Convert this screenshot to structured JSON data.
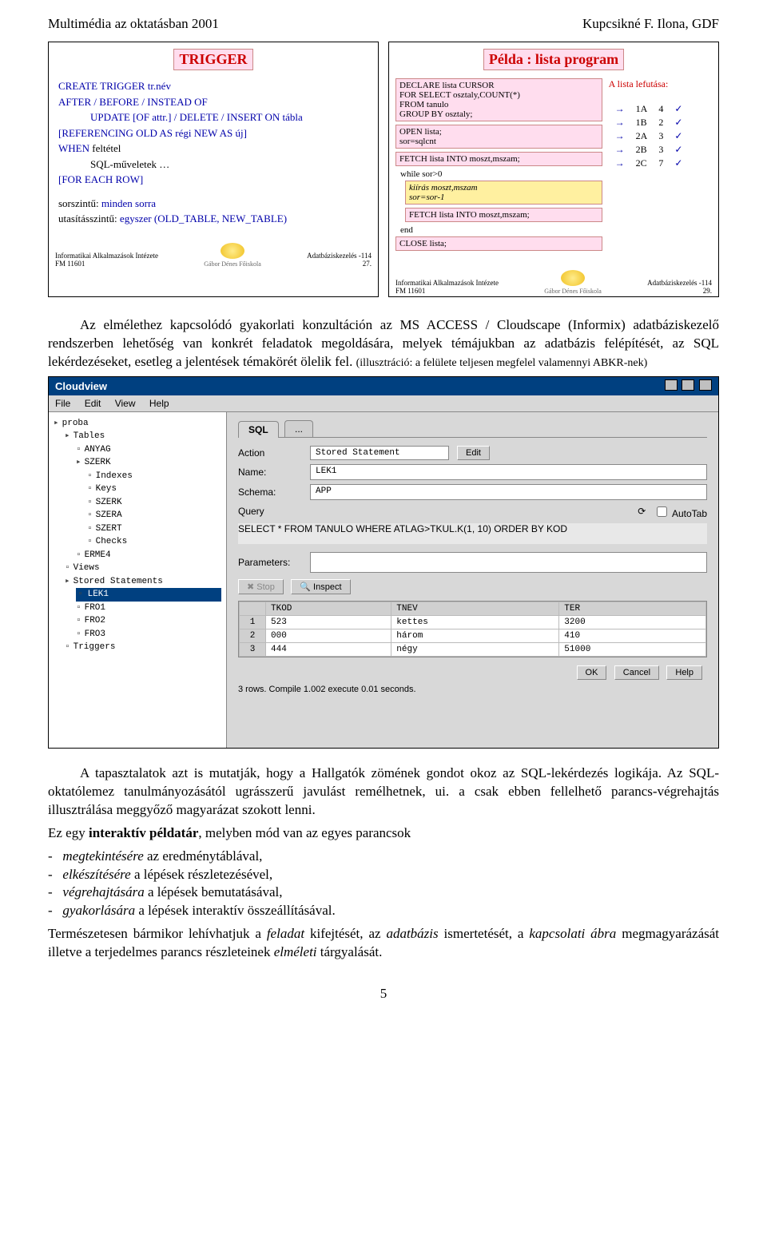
{
  "header": {
    "left": "Multimédia az oktatásban 2001",
    "right": "Kupcsikné F. Ilona, GDF"
  },
  "slide1": {
    "title": "TRIGGER",
    "l1": "CREATE TRIGGER tr.név",
    "l2": "AFTER / BEFORE / INSTEAD OF",
    "l3": "UPDATE [OF attr.] / DELETE / INSERT  ON tábla",
    "l4": "[REFERENCING  OLD AS régi   NEW AS új]",
    "l5a": "WHEN ",
    "l5b": "feltétel",
    "l6": "SQL-műveletek …",
    "l7": "[FOR EACH ROW]",
    "l8a": "sorszintű: ",
    "l8b": "minden sorra",
    "l9a": "utasításszintű: ",
    "l9b": "egyszer (OLD_TABLE, NEW_TABLE)",
    "foot_left1": "Informatikai Alkalmazások Intézete",
    "foot_left2": "FM 11601",
    "foot_mid": "Gábor Dénes Főiskola",
    "foot_right1": "Adatbáziskezelés -114",
    "foot_right2": "27."
  },
  "slide2": {
    "title": "Példa : lista program",
    "c1": "DECLARE lista CURSOR\nFOR SELECT osztaly,COUNT(*)\nFROM tanulo\nGROUP BY osztaly;",
    "c2": "OPEN lista;\nsor=sqlcnt",
    "c3": "FETCH lista INTO moszt,mszam;",
    "p1": "while sor>0",
    "c4": "kiírás moszt,mszam\nsor=sor-1",
    "c5": "FETCH lista INTO moszt,mszam;",
    "p2": "end",
    "c6": "CLOSE lista;",
    "right_title": "A lista lefutása:",
    "rows": [
      {
        "k": "1A",
        "v": "4"
      },
      {
        "k": "1B",
        "v": "2"
      },
      {
        "k": "2A",
        "v": "3"
      },
      {
        "k": "2B",
        "v": "3"
      },
      {
        "k": "2C",
        "v": "7"
      }
    ],
    "foot_left1": "Informatikai Alkalmazások Intézete",
    "foot_left2": "FM 11601",
    "foot_mid": "Gábor Dénes Főiskola",
    "foot_right1": "Adatbáziskezelés -114",
    "foot_right2": "29."
  },
  "para1": "Az elmélethez kapcsolódó gyakorlati konzultáción az MS ACCESS / Cloudscape (Informix) adatbáziskezelő rendszerben lehetőség van konkrét feladatok megoldására, melyek témájukban az adatbázis felépítését, az SQL lekérdezéseket, esetleg a jelentések témakörét ölelik fel. ",
  "para1_small": "(illusztráció: a felülete teljesen megfelel valamennyi ABKR-nek)",
  "screenshot": {
    "title": "Cloudview",
    "menu": [
      "File",
      "Edit",
      "View",
      "Help"
    ],
    "tree": [
      {
        "t": "proba",
        "cls": "node"
      },
      {
        "t": "Tables",
        "cls": "node ind1"
      },
      {
        "t": "ANYAG",
        "cls": "leaf ind2"
      },
      {
        "t": "SZERK",
        "cls": "node ind2"
      },
      {
        "t": "Indexes",
        "cls": "leaf ind3"
      },
      {
        "t": "Keys",
        "cls": "leaf ind3"
      },
      {
        "t": "SZERK",
        "cls": "leaf ind3"
      },
      {
        "t": "SZERA",
        "cls": "leaf ind3"
      },
      {
        "t": "SZERT",
        "cls": "leaf ind3"
      },
      {
        "t": "Checks",
        "cls": "leaf ind3"
      },
      {
        "t": "ERME4",
        "cls": "leaf ind2"
      },
      {
        "t": "Views",
        "cls": "leaf ind1"
      },
      {
        "t": "Stored Statements",
        "cls": "node ind1"
      },
      {
        "t": "LEK1",
        "cls": "leaf ind2 sel"
      },
      {
        "t": "FRO1",
        "cls": "leaf ind2"
      },
      {
        "t": "FRO2",
        "cls": "leaf ind2"
      },
      {
        "t": "FRO3",
        "cls": "leaf ind2"
      },
      {
        "t": "Triggers",
        "cls": "leaf ind1"
      }
    ],
    "tabs": {
      "t1": "SQL",
      "t2": "..."
    },
    "action_label": "Action",
    "action_value": "Stored Statement",
    "action_btn": "Edit",
    "name_label": "Name:",
    "name_value": "LEK1",
    "schema_label": "Schema:",
    "schema_value": "APP",
    "query_label": "Query",
    "query_icon": "⟳",
    "autotab": "AutoTab",
    "query_text": "SELECT * FROM TANULO WHERE ATLAG>TKUL.K(1, 10) ORDER BY KOD",
    "params_label": "Parameters:",
    "stop_btn": "Stop",
    "inspect_btn": "Inspect",
    "grid_cols": [
      "",
      "TKOD",
      "TNEV",
      "TER"
    ],
    "grid_rows": [
      [
        "1",
        "523",
        "kettes",
        "3200"
      ],
      [
        "2",
        "000",
        "három",
        "410"
      ],
      [
        "3",
        "444",
        "négy",
        "51000"
      ]
    ],
    "ok_btn": "OK",
    "cancel_btn": "Cancel",
    "help_btn": "Help",
    "status": "3 rows.  Compile  1.002 execute  0.01 seconds."
  },
  "para2": "A tapasztalatok azt is mutatják, hogy a Hallgatók zömének gondot okoz az SQL-lekérdezés logikája. Az SQL-oktatólemez tanulmányozásától ugrásszerű javulást remélhetnek, ui. a csak ebben fellelhető parancs-végrehajtás illusztrálása meggyőző magyarázat szokott lenni.",
  "para3_lead": "Ez egy ",
  "para3_bold": "interaktív példatár",
  "para3_tail": ", melyben mód van az egyes parancsok",
  "bullets": [
    {
      "em": "megtekintésére",
      "rest": " az eredménytáblával,"
    },
    {
      "em": "elkészítésére",
      "rest": " a lépések részletezésével,"
    },
    {
      "em": "végrehajtására",
      "rest": " a lépések bemutatásával,"
    },
    {
      "em": "gyakorlására",
      "rest": " a lépések interaktív összeállításával."
    }
  ],
  "para4_a": "Természetesen bármikor lehívhatjuk a ",
  "para4_b": "feladat",
  "para4_c": " kifejtését, az ",
  "para4_d": "adatbázis",
  "para4_e": " ismertetését, a ",
  "para4_f": "kapcsolati ábra",
  "para4_g": " megmagyarázását illetve a terjedelmes parancs részleteinek ",
  "para4_h": "elméleti",
  "para4_i": " tárgyalását.",
  "pagenum": "5"
}
